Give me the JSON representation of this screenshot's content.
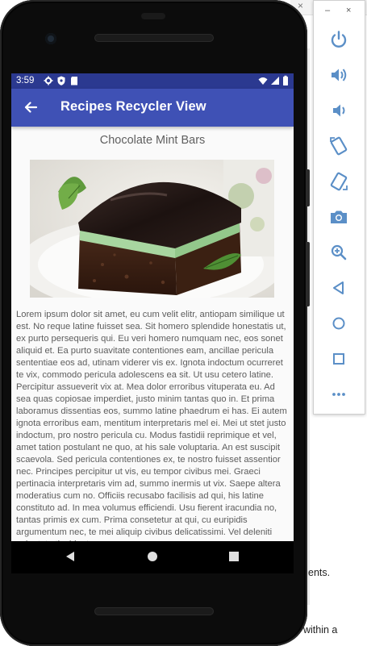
{
  "status_bar": {
    "time": "3:59"
  },
  "app_bar": {
    "title": "Recipes Recycler View"
  },
  "recipe": {
    "title": "Chocolate Mint Bars",
    "description": "Lorem ipsum dolor sit amet, eu cum velit elitr, antiopam similique ut est. No reque latine fuisset sea. Sit homero splendide honestatis ut, ex purto persequeris qui. Eu veri homero numquam nec, eos sonet aliquid et. Ea purto suavitate contentiones eam, ancillae pericula sententiae eos ad, utinam viderer vis ex. Ignota indoctum ocurreret te vix, commodo pericula adolescens ea sit. Ut usu cetero latine. Percipitur assueverit vix at. Mea dolor erroribus vituperata eu. Ad sea quas copiosae imperdiet, justo minim tantas quo in. Et prima laboramus dissentias eos, summo latine phaedrum ei has. Ei autem ignota erroribus eam, mentitum interpretaris mel ei. Mei ut stet justo indoctum, pro nostro pericula cu. Modus fastidii reprimique et vel, amet tation postulant ne quo, at his sale voluptaria. An est suscipit scaevola. Sed pericula contentiones ex, te nostro fuisset assentior nec. Principes percipitur ut vis, eu tempor civibus mei. Graeci pertinacia interpretaris vim ad, summo inermis ut vix. Saepe altera moderatius cum no. Officiis recusabo facilisis ad qui, his latine constituto ad. In mea volumus efficiendi. Usu fierent iracundia no, tantas primis ex cum. Prima consetetur at qui, cu euripidis argumentum nec, te mei aliquip civibus delicatissimi. Vel deleniti vulputate tincidunt"
  },
  "background_window": {
    "close_glyph": "×",
    "text_line_1": "ents.",
    "text_line_2": "within a"
  },
  "emulator_toolbar": {
    "minimize": "–",
    "close": "×",
    "buttons": [
      "power-icon",
      "volume-up-icon",
      "volume-down-icon",
      "rotate-left-icon",
      "rotate-right-icon",
      "camera-icon",
      "zoom-icon",
      "back-icon",
      "home-icon",
      "overview-icon",
      "more-icon"
    ]
  },
  "colors": {
    "status_bar": "#2b3990",
    "app_bar": "#3f51b5",
    "toolbar_icon": "#5b8fc7"
  }
}
